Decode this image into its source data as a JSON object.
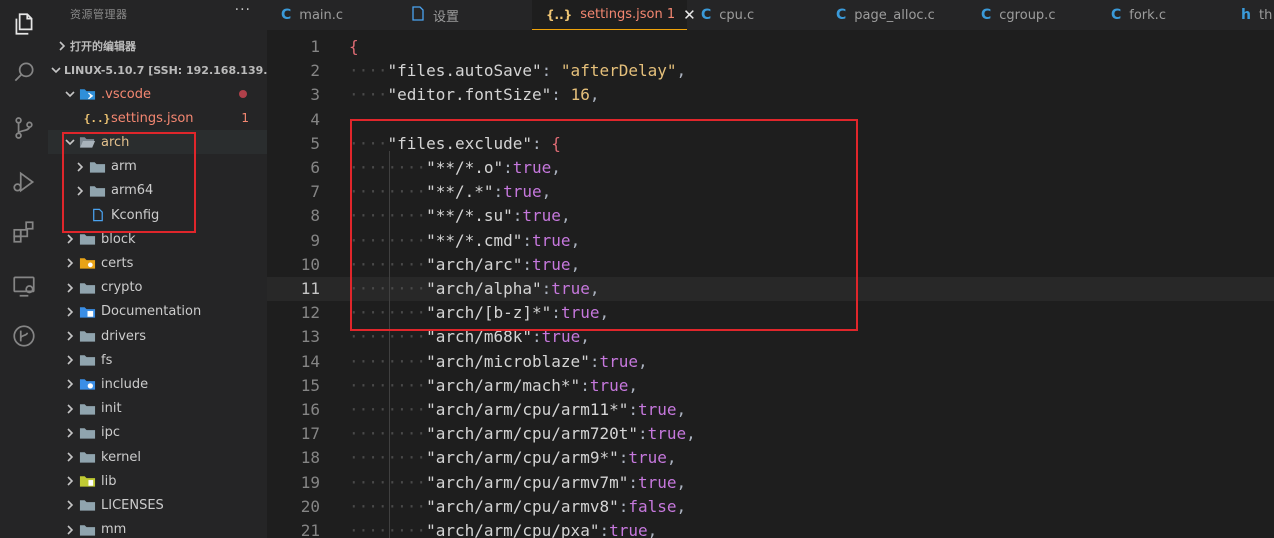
{
  "sidebar": {
    "title": "资源管理器",
    "more": "···",
    "open_editors": "打开的编辑器",
    "workspace": "LINUX-5.10.7 [SSH: 192.168.139...",
    "items": [
      {
        "label": ".vscode",
        "depth": 1,
        "kind": "folder-vscode",
        "expanded": true,
        "modified": true
      },
      {
        "label": "settings.json",
        "depth": 2,
        "kind": "json",
        "badge": "1"
      },
      {
        "label": "arch",
        "depth": 1,
        "kind": "folder-open",
        "expanded": true
      },
      {
        "label": "arm",
        "depth": 2,
        "kind": "folder"
      },
      {
        "label": "arm64",
        "depth": 2,
        "kind": "folder"
      },
      {
        "label": "Kconfig",
        "depth": 2,
        "kind": "file"
      },
      {
        "label": "block",
        "depth": 1,
        "kind": "folder"
      },
      {
        "label": "certs",
        "depth": 1,
        "kind": "folder-certs"
      },
      {
        "label": "crypto",
        "depth": 1,
        "kind": "folder"
      },
      {
        "label": "Documentation",
        "depth": 1,
        "kind": "folder-docs"
      },
      {
        "label": "drivers",
        "depth": 1,
        "kind": "folder"
      },
      {
        "label": "fs",
        "depth": 1,
        "kind": "folder"
      },
      {
        "label": "include",
        "depth": 1,
        "kind": "folder-include"
      },
      {
        "label": "init",
        "depth": 1,
        "kind": "folder"
      },
      {
        "label": "ipc",
        "depth": 1,
        "kind": "folder"
      },
      {
        "label": "kernel",
        "depth": 1,
        "kind": "folder"
      },
      {
        "label": "lib",
        "depth": 1,
        "kind": "folder-lib"
      },
      {
        "label": "LICENSES",
        "depth": 1,
        "kind": "folder"
      },
      {
        "label": "mm",
        "depth": 1,
        "kind": "folder"
      }
    ]
  },
  "tabs": [
    {
      "label": "main.c",
      "icon": "C",
      "active": false
    },
    {
      "label": "设置",
      "icon": "file",
      "active": false
    },
    {
      "label": "settings.json 1",
      "icon": "{..}",
      "active": true
    },
    {
      "label": "cpu.c",
      "icon": "C",
      "active": false
    },
    {
      "label": "page_alloc.c",
      "icon": "C",
      "active": false
    },
    {
      "label": "cgroup.c",
      "icon": "C",
      "active": false
    },
    {
      "label": "fork.c",
      "icon": "C",
      "active": false
    },
    {
      "label": "th",
      "icon": "h",
      "active": false
    }
  ],
  "editor": {
    "current_line": 11,
    "lines": [
      {
        "n": "1",
        "indent": 0,
        "tokens": [
          [
            "br",
            "{"
          ]
        ]
      },
      {
        "n": "2",
        "indent": 4,
        "tokens": [
          [
            "k",
            "\"files.autoSave\""
          ],
          [
            "p",
            ": "
          ],
          [
            "s",
            "\"afterDelay\""
          ],
          [
            "p",
            ","
          ]
        ]
      },
      {
        "n": "3",
        "indent": 4,
        "tokens": [
          [
            "k",
            "\"editor.fontSize\""
          ],
          [
            "p",
            ": "
          ],
          [
            "s",
            "16"
          ],
          [
            "p",
            ","
          ]
        ]
      },
      {
        "n": "4",
        "indent": 0,
        "tokens": []
      },
      {
        "n": "5",
        "indent": 4,
        "tokens": [
          [
            "k",
            "\"files.exclude\""
          ],
          [
            "p",
            ": "
          ],
          [
            "br",
            "{"
          ]
        ]
      },
      {
        "n": "6",
        "indent": 8,
        "tokens": [
          [
            "k",
            "\"**/*.o\""
          ],
          [
            "p",
            ":"
          ],
          [
            "b",
            "true"
          ],
          [
            "p",
            ","
          ]
        ]
      },
      {
        "n": "7",
        "indent": 8,
        "tokens": [
          [
            "k",
            "\"**/.*\""
          ],
          [
            "p",
            ":"
          ],
          [
            "b",
            "true"
          ],
          [
            "p",
            ","
          ]
        ]
      },
      {
        "n": "8",
        "indent": 8,
        "tokens": [
          [
            "k",
            "\"**/*.su\""
          ],
          [
            "p",
            ":"
          ],
          [
            "b",
            "true"
          ],
          [
            "p",
            ","
          ]
        ]
      },
      {
        "n": "9",
        "indent": 8,
        "tokens": [
          [
            "k",
            "\"**/*.cmd\""
          ],
          [
            "p",
            ":"
          ],
          [
            "b",
            "true"
          ],
          [
            "p",
            ","
          ]
        ]
      },
      {
        "n": "10",
        "indent": 8,
        "tokens": [
          [
            "k",
            "\"arch/arc\""
          ],
          [
            "p",
            ":"
          ],
          [
            "b",
            "true"
          ],
          [
            "p",
            ","
          ]
        ]
      },
      {
        "n": "11",
        "indent": 8,
        "tokens": [
          [
            "k",
            "\"arch/alpha\""
          ],
          [
            "p",
            ":"
          ],
          [
            "b",
            "true"
          ],
          [
            "p",
            ","
          ]
        ]
      },
      {
        "n": "12",
        "indent": 8,
        "tokens": [
          [
            "k",
            "\"arch/[b-z]*\""
          ],
          [
            "p",
            ":"
          ],
          [
            "b",
            "true"
          ],
          [
            "p",
            ","
          ]
        ]
      },
      {
        "n": "13",
        "indent": 8,
        "tokens": [
          [
            "k",
            "\"arch/m68k\""
          ],
          [
            "p",
            ":"
          ],
          [
            "b",
            "true"
          ],
          [
            "p",
            ","
          ]
        ]
      },
      {
        "n": "14",
        "indent": 8,
        "tokens": [
          [
            "k",
            "\"arch/microblaze\""
          ],
          [
            "p",
            ":"
          ],
          [
            "b",
            "true"
          ],
          [
            "p",
            ","
          ]
        ]
      },
      {
        "n": "15",
        "indent": 8,
        "tokens": [
          [
            "k",
            "\"arch/arm/mach*\""
          ],
          [
            "p",
            ":"
          ],
          [
            "b",
            "true"
          ],
          [
            "p",
            ","
          ]
        ]
      },
      {
        "n": "16",
        "indent": 8,
        "tokens": [
          [
            "k",
            "\"arch/arm/cpu/arm11*\""
          ],
          [
            "p",
            ":"
          ],
          [
            "b",
            "true"
          ],
          [
            "p",
            ","
          ]
        ]
      },
      {
        "n": "17",
        "indent": 8,
        "tokens": [
          [
            "k",
            "\"arch/arm/cpu/arm720t\""
          ],
          [
            "p",
            ":"
          ],
          [
            "b",
            "true"
          ],
          [
            "p",
            ","
          ]
        ]
      },
      {
        "n": "18",
        "indent": 8,
        "tokens": [
          [
            "k",
            "\"arch/arm/cpu/arm9*\""
          ],
          [
            "p",
            ":"
          ],
          [
            "b",
            "true"
          ],
          [
            "p",
            ","
          ]
        ]
      },
      {
        "n": "19",
        "indent": 8,
        "tokens": [
          [
            "k",
            "\"arch/arm/cpu/armv7m\""
          ],
          [
            "p",
            ":"
          ],
          [
            "b",
            "true"
          ],
          [
            "p",
            ","
          ]
        ]
      },
      {
        "n": "20",
        "indent": 8,
        "tokens": [
          [
            "k",
            "\"arch/arm/cpu/armv8\""
          ],
          [
            "p",
            ":"
          ],
          [
            "b",
            "false"
          ],
          [
            "p",
            ","
          ]
        ]
      },
      {
        "n": "21",
        "indent": 8,
        "tokens": [
          [
            "k",
            "\"arch/arm/cpu/pxa\""
          ],
          [
            "p",
            ":"
          ],
          [
            "b",
            "true"
          ],
          [
            "p",
            ","
          ]
        ]
      }
    ]
  },
  "colors": {
    "accent_tab": "#f0a30a",
    "annotation": "#e0262b",
    "error": "#f48771",
    "modified_dot": "#b0404a"
  }
}
